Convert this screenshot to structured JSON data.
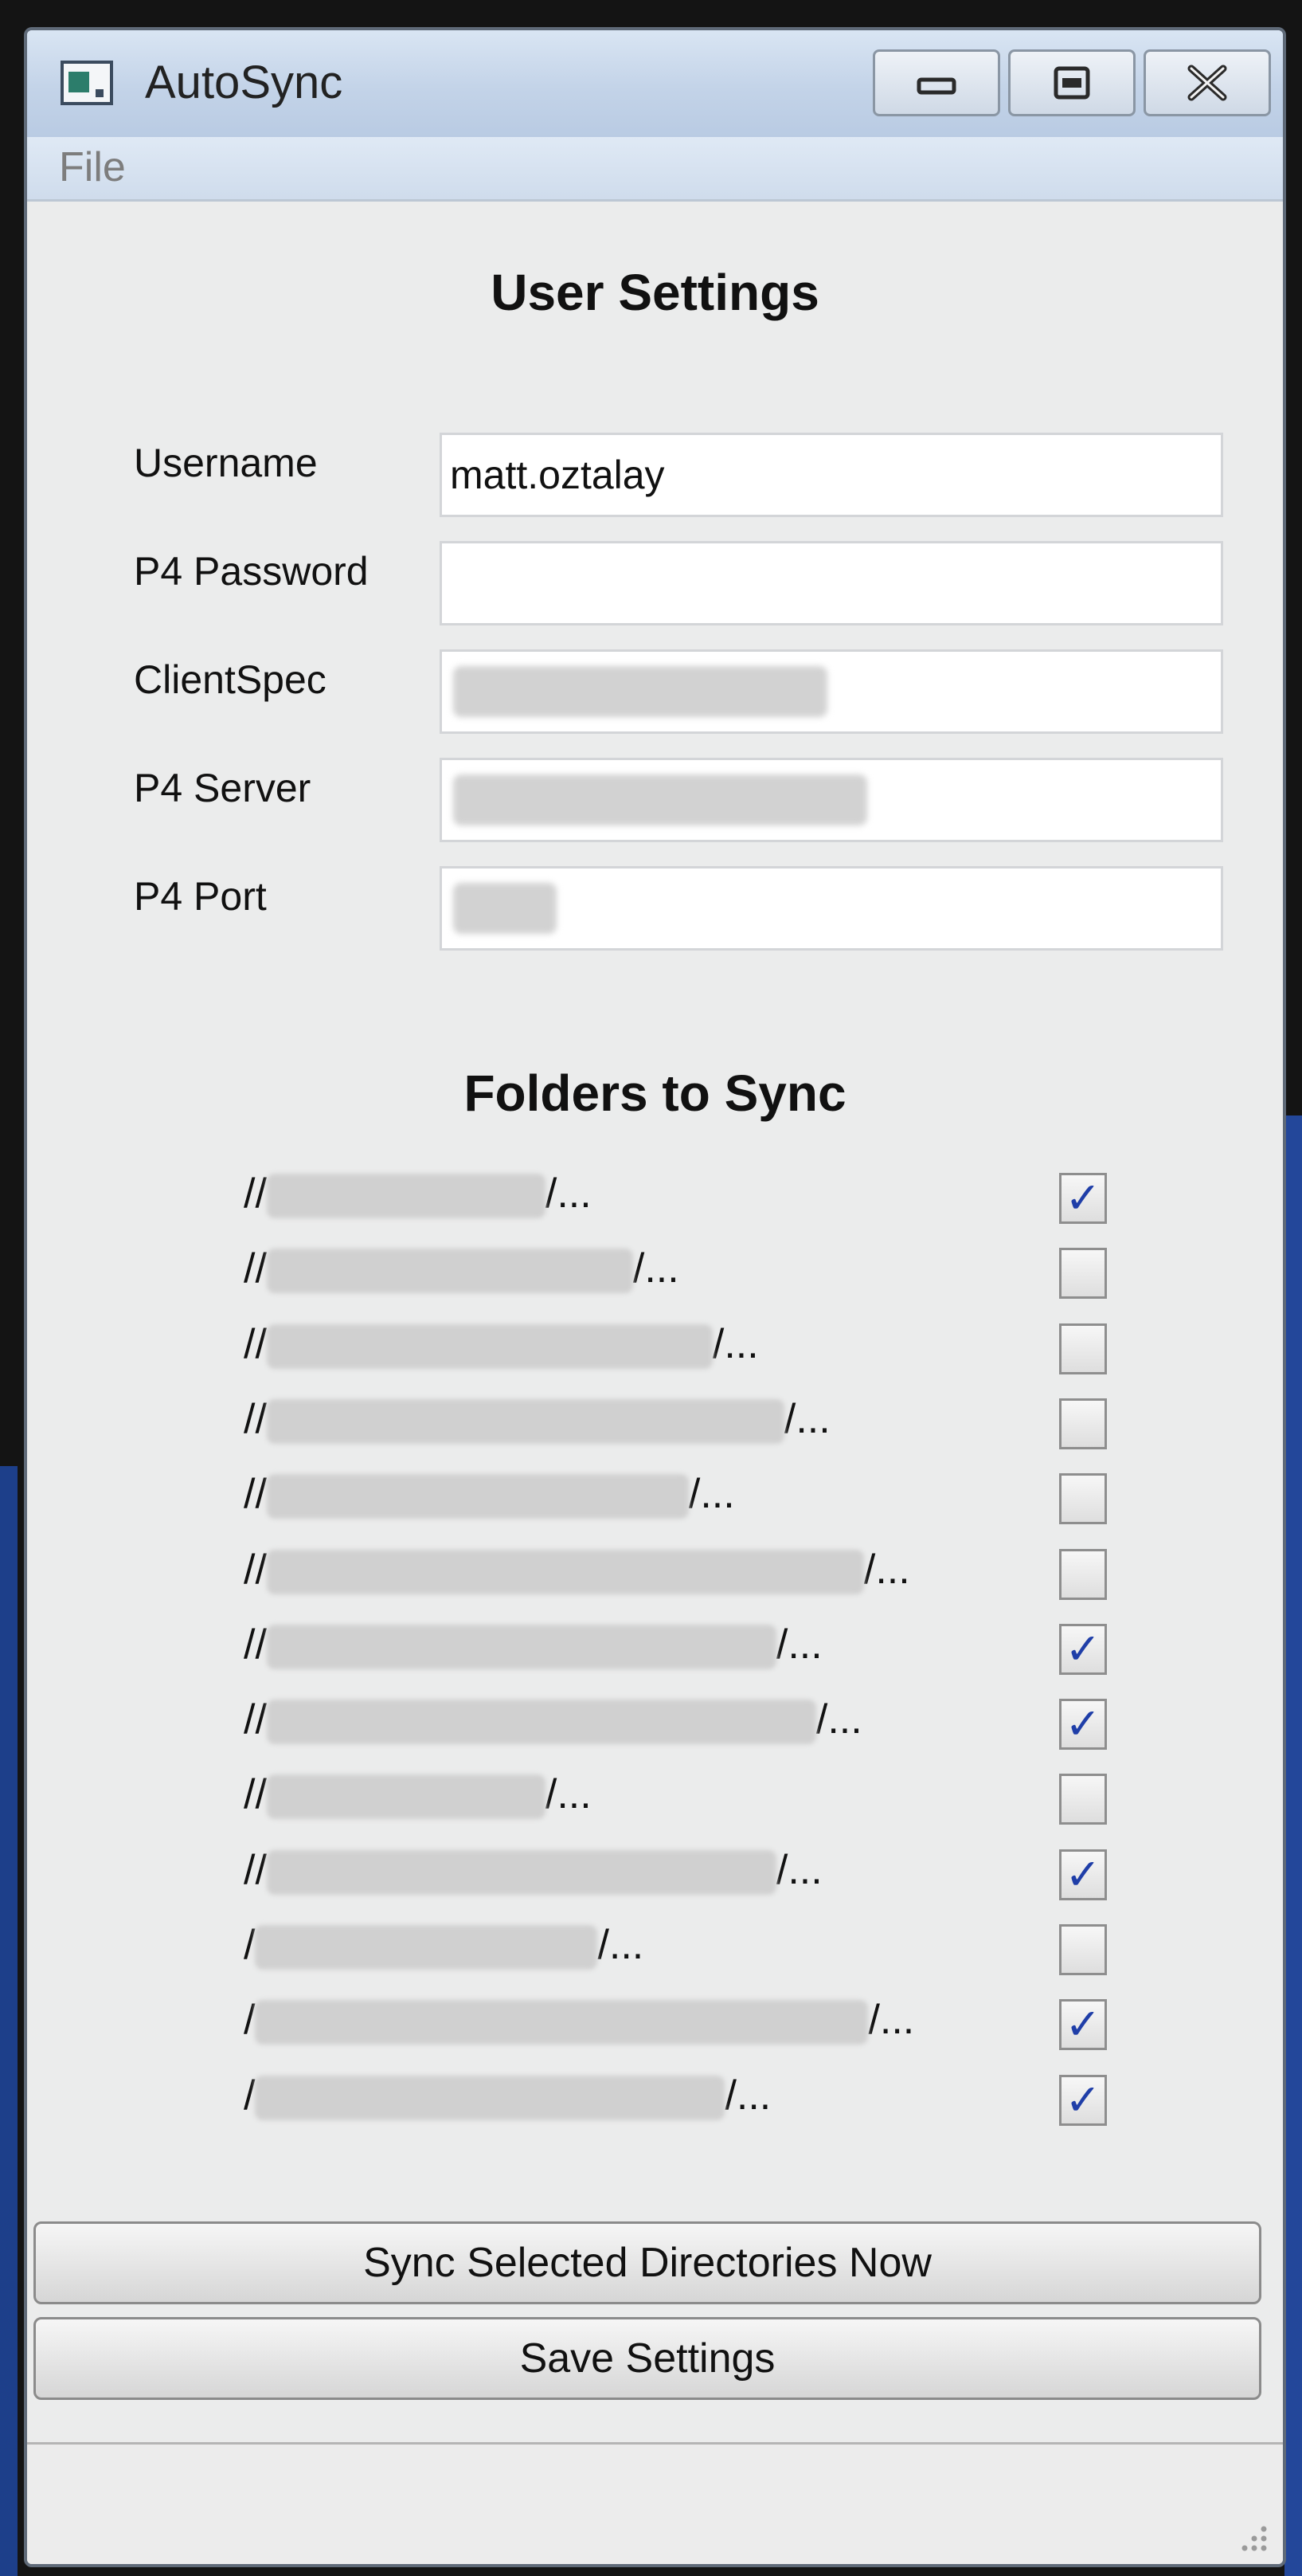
{
  "window": {
    "title": "AutoSync",
    "icon": "app-window-icon",
    "controls": [
      "minimize-icon",
      "maximize-icon",
      "close-icon"
    ]
  },
  "menu": {
    "file": "File"
  },
  "user_settings": {
    "title": "User Settings",
    "fields": [
      {
        "label": "Username",
        "value": "matt.oztalay"
      },
      {
        "label": "P4 Password",
        "value": ""
      },
      {
        "label": "ClientSpec",
        "value": ""
      },
      {
        "label": "P4 Server",
        "value": ""
      },
      {
        "label": "P4 Port",
        "value": ""
      }
    ]
  },
  "folders": {
    "title": "Folders to Sync",
    "items": [
      {
        "prefix": "//",
        "suffix": "/...",
        "checked": true
      },
      {
        "prefix": "//",
        "suffix": "/...",
        "checked": false
      },
      {
        "prefix": "//",
        "suffix": "/...",
        "checked": false
      },
      {
        "prefix": "//",
        "suffix": "/...",
        "checked": false
      },
      {
        "prefix": "//",
        "suffix": "/...",
        "checked": false
      },
      {
        "prefix": "//",
        "suffix": "/...",
        "checked": false
      },
      {
        "prefix": "//",
        "suffix": "/...",
        "checked": true
      },
      {
        "prefix": "//",
        "suffix": "/...",
        "checked": true
      },
      {
        "prefix": "//",
        "suffix": "/...",
        "checked": false
      },
      {
        "prefix": "//",
        "suffix": "/...",
        "checked": true
      },
      {
        "prefix": "/",
        "suffix": "/...",
        "checked": false
      },
      {
        "prefix": "/",
        "suffix": "/...",
        "checked": true
      },
      {
        "prefix": "/",
        "suffix": "/...",
        "checked": true
      }
    ]
  },
  "buttons": {
    "sync": "Sync Selected Directories Now",
    "save": "Save Settings"
  },
  "colors": {
    "titlebar": "#c8d7ea",
    "window_bg": "#ebecec",
    "check_mark": "#1f3ea8"
  }
}
